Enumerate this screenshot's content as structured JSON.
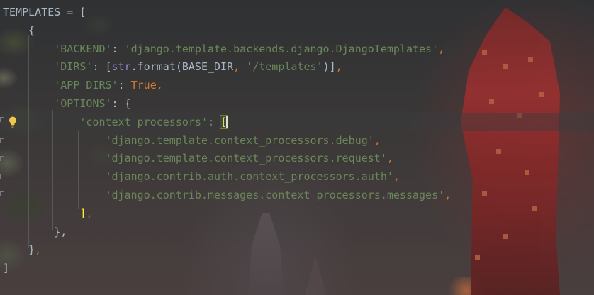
{
  "editor": {
    "language": "python",
    "lines": [
      {
        "tokens": [
          {
            "t": "id",
            "v": "TEMPLATES"
          },
          {
            "t": "id",
            "v": " = "
          },
          {
            "t": "brk",
            "v": "["
          }
        ]
      },
      {
        "tokens": [
          {
            "t": "id",
            "v": "    {"
          }
        ]
      },
      {
        "tokens": [
          {
            "t": "id",
            "v": "        "
          },
          {
            "t": "str",
            "v": "'BACKEND'"
          },
          {
            "t": "id",
            "v": ": "
          },
          {
            "t": "str",
            "v": "'django.template.backends.django.DjangoTemplates'"
          },
          {
            "t": "kw",
            "v": ","
          }
        ]
      },
      {
        "tokens": [
          {
            "t": "id",
            "v": "        "
          },
          {
            "t": "str",
            "v": "'DIRS'"
          },
          {
            "t": "id",
            "v": ": ["
          },
          {
            "t": "fn",
            "v": "str"
          },
          {
            "t": "id",
            "v": ".format(BASE_DIR"
          },
          {
            "t": "kw",
            "v": ", "
          },
          {
            "t": "str",
            "v": "'/templates'"
          },
          {
            "t": "id",
            "v": ")]"
          },
          {
            "t": "kw",
            "v": ","
          }
        ]
      },
      {
        "tokens": [
          {
            "t": "id",
            "v": "        "
          },
          {
            "t": "str",
            "v": "'APP_DIRS'"
          },
          {
            "t": "id",
            "v": ": "
          },
          {
            "t": "kw",
            "v": "True"
          },
          {
            "t": "kw",
            "v": ","
          }
        ]
      },
      {
        "tokens": [
          {
            "t": "id",
            "v": "        "
          },
          {
            "t": "str",
            "v": "'OPTIONS'"
          },
          {
            "t": "id",
            "v": ": {"
          }
        ]
      },
      {
        "tokens": [
          {
            "t": "id",
            "v": "            "
          },
          {
            "t": "str",
            "v": "'context_processors'"
          },
          {
            "t": "id",
            "v": ": "
          },
          {
            "t": "brkhl",
            "v": "["
          }
        ]
      },
      {
        "tokens": [
          {
            "t": "id",
            "v": "                "
          },
          {
            "t": "str",
            "v": "'django.template.context_processors.debug'"
          },
          {
            "t": "kw",
            "v": ","
          }
        ]
      },
      {
        "tokens": [
          {
            "t": "id",
            "v": "                "
          },
          {
            "t": "str",
            "v": "'django.template.context_processors.request'"
          },
          {
            "t": "kw",
            "v": ","
          }
        ]
      },
      {
        "tokens": [
          {
            "t": "id",
            "v": "                "
          },
          {
            "t": "str",
            "v": "'django.contrib.auth.context_processors.auth'"
          },
          {
            "t": "kw",
            "v": ","
          }
        ]
      },
      {
        "tokens": [
          {
            "t": "id",
            "v": "                "
          },
          {
            "t": "str",
            "v": "'django.contrib.messages.context_processors.messages'"
          },
          {
            "t": "kw",
            "v": ","
          }
        ]
      },
      {
        "tokens": [
          {
            "t": "id",
            "v": "            "
          },
          {
            "t": "brkhl2",
            "v": "]"
          },
          {
            "t": "kw",
            "v": ","
          }
        ]
      },
      {
        "tokens": [
          {
            "t": "id",
            "v": "        },"
          }
        ]
      },
      {
        "tokens": [
          {
            "t": "id",
            "v": "    }"
          },
          {
            "t": "kw",
            "v": ","
          }
        ]
      },
      {
        "tokens": [
          {
            "t": "id",
            "v": "]"
          }
        ]
      }
    ],
    "caret_line": 6,
    "intention_icon": "lightbulb-icon"
  },
  "colors": {
    "string": "#6a8759",
    "keyword": "#cc7832",
    "builtin": "#8888c6",
    "identifier": "#a9b7c6",
    "bracket_highlight": "#ffef28"
  }
}
